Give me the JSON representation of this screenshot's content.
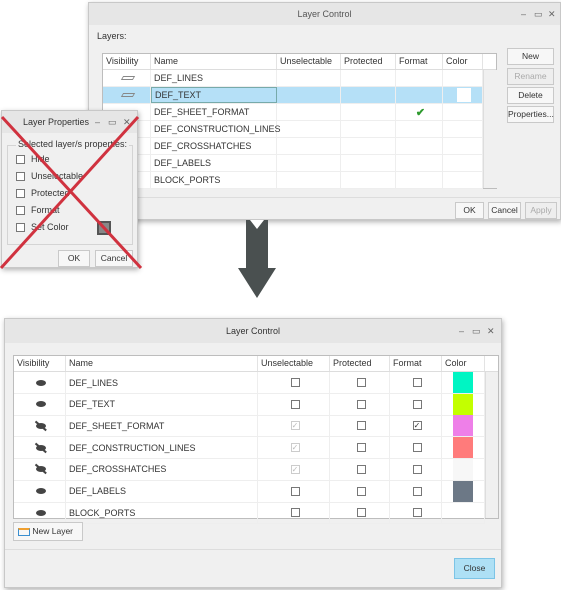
{
  "top_dialog": {
    "title": "Layer Control",
    "layers_label": "Layers:",
    "columns": [
      "Visibility",
      "Name",
      "Unselectable",
      "Protected",
      "Format",
      "Color"
    ],
    "rows": [
      {
        "name": "DEF_LINES",
        "format": false,
        "color": ""
      },
      {
        "name": "DEF_TEXT",
        "selected": true,
        "format": false,
        "color": "#ffffff"
      },
      {
        "name": "DEF_SHEET_FORMAT",
        "format": true,
        "color": ""
      },
      {
        "name": "DEF_CONSTRUCTION_LINES",
        "format": false,
        "color": ""
      },
      {
        "name": "DEF_CROSSHATCHES",
        "format": false,
        "color": ""
      },
      {
        "name": "DEF_LABELS",
        "format": false,
        "color": ""
      },
      {
        "name": "BLOCK_PORTS",
        "format": false,
        "color": ""
      }
    ],
    "buttons": {
      "new": "New",
      "rename": "Rename",
      "delete": "Delete",
      "properties": "Properties...",
      "ok": "OK",
      "cancel": "Cancel",
      "apply": "Apply"
    }
  },
  "props_dialog": {
    "title": "Layer Properties",
    "group_label": "Selected layer/s properties:",
    "options": [
      "Hide",
      "Unselectable",
      "Protected",
      "Format",
      "Set Color"
    ],
    "ok": "OK",
    "cancel": "Cancel",
    "cross_color": "#d0323f"
  },
  "bottom_dialog": {
    "title": "Layer Control",
    "columns": [
      "Visibility",
      "Name",
      "Unselectable",
      "Protected",
      "Format",
      "Color"
    ],
    "rows": [
      {
        "visible": true,
        "name": "DEF_LINES",
        "unselectable": false,
        "protected": false,
        "format": false,
        "color": "#00f5c3"
      },
      {
        "visible": true,
        "name": "DEF_TEXT",
        "unselectable": false,
        "protected": false,
        "format": false,
        "color": "#c3ff00"
      },
      {
        "visible": false,
        "name": "DEF_SHEET_FORMAT",
        "unselectable": true,
        "protected": false,
        "format": true,
        "color": "#ee7fe8"
      },
      {
        "visible": false,
        "name": "DEF_CONSTRUCTION_LINES",
        "unselectable": true,
        "protected": false,
        "format": false,
        "color": "#ff7b7b"
      },
      {
        "visible": false,
        "name": "DEF_CROSSHATCHES",
        "unselectable": true,
        "protected": false,
        "format": false,
        "color": "#f7f7f7"
      },
      {
        "visible": true,
        "name": "DEF_LABELS",
        "unselectable": false,
        "protected": false,
        "format": false,
        "color": "#6c7886"
      },
      {
        "visible": true,
        "name": "BLOCK_PORTS",
        "unselectable": false,
        "protected": false,
        "format": false,
        "color": ""
      }
    ],
    "new_layer": "New Layer",
    "close": "Close"
  }
}
